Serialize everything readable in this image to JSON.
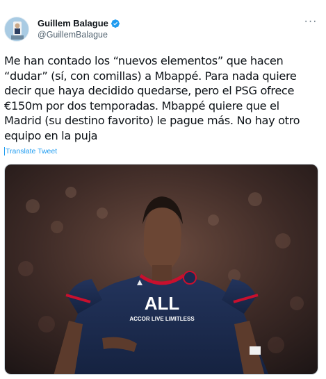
{
  "author": {
    "display_name": "Guillem Balague",
    "handle": "@GuillemBalague",
    "verified": true,
    "avatar_icon": "profile-photo-icon"
  },
  "more_icon": "ellipsis-icon",
  "tweet": {
    "text_lines": [
      "Me han contado los “nuevos elementos” que hacen",
      "“dudar” (sí, con comillas) a Mbappé. Para nada quiere",
      "decir que haya decidido quedarse, pero el PSG ofrece",
      "€150m por dos temporadas. Mbappé quiere que el",
      "Madrid (su destino favorito) le pague más. No hay otro",
      "equipo en la puja"
    ],
    "translate_label": "Translate Tweet"
  },
  "media": {
    "shirt_sponsor": "ALL",
    "shirt_sponsor_sub": "ACCOR LIVE LIMITLESS"
  },
  "colors": {
    "link": "#1d9bf0",
    "verified": "#1d9bf0",
    "text": "#0f1419",
    "muted": "#536471",
    "shirt": "#1b2a4e",
    "shirt_trim": "#c8102e"
  }
}
